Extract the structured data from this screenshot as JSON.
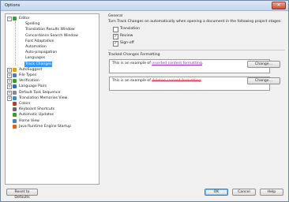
{
  "window": {
    "title": "Options",
    "close_glyph": "✕"
  },
  "tree": {
    "items": [
      {
        "label": "Editor",
        "icon": "editor-icon",
        "color": "#3d9a3a",
        "expander": "−"
      },
      {
        "label": "Spelling"
      },
      {
        "label": "Translation Results Window"
      },
      {
        "label": "Concordance Search Window"
      },
      {
        "label": "Font Adaptation"
      },
      {
        "label": "Automation"
      },
      {
        "label": "Auto-propagation"
      },
      {
        "label": "Languages"
      },
      {
        "label": "Track Changes",
        "selected": true
      },
      {
        "label": "AutoSuggest",
        "icon": "autosuggest-icon",
        "color": "#d9a51e",
        "expander": "+"
      },
      {
        "label": "File Types",
        "icon": "file-types-icon",
        "color": "#4a7fc0",
        "expander": "+"
      },
      {
        "label": "Verification",
        "icon": "verification-icon",
        "color": "#3d9a3a",
        "expander": "+"
      },
      {
        "label": "Language Pairs",
        "icon": "language-pairs-icon",
        "color": "#2f6fb5",
        "expander": "+"
      },
      {
        "label": "Default Task Sequence",
        "icon": "task-sequence-icon",
        "color": "#8a8a8a",
        "expander": "+"
      },
      {
        "label": "Translation Memories View",
        "icon": "tm-view-icon",
        "color": "#3a8fc7",
        "expander": "+"
      },
      {
        "label": "Colors",
        "icon": "colors-icon",
        "color": "#c0392b"
      },
      {
        "label": "Keyboard Shortcuts",
        "icon": "keyboard-icon",
        "color": "#6b6b6b"
      },
      {
        "label": "Automatic Updates",
        "icon": "updates-icon",
        "color": "#3d9a3a"
      },
      {
        "label": "Home View",
        "icon": "home-view-icon",
        "color": "#4a7fc0"
      },
      {
        "label": "Java Runtime Engine Startup",
        "icon": "java-icon",
        "color": "#d06a1e"
      }
    ]
  },
  "general": {
    "heading": "General",
    "description": "Turn Track Changes on automatically when opening a document in the following project stages:",
    "stages": [
      {
        "label": "Translation",
        "checked": false,
        "mark": ""
      },
      {
        "label": "Review",
        "checked": true,
        "mark": "✓"
      },
      {
        "label": "Sign-off",
        "checked": true,
        "mark": "✓"
      }
    ]
  },
  "formatting": {
    "heading": "Tracked Changes Formatting",
    "insert_prefix": "This is an example of ",
    "insert_example": "inserted content formatting",
    "insert_suffix": ".",
    "delete_prefix": "This is an example of ",
    "delete_example": "deleted content formatting",
    "delete_suffix": ".",
    "change_label": "Change..."
  },
  "footer": {
    "reset_label": "Reset to Defaults",
    "ok_label": "OK",
    "cancel_label": "Cancel",
    "help_label": "Help"
  }
}
